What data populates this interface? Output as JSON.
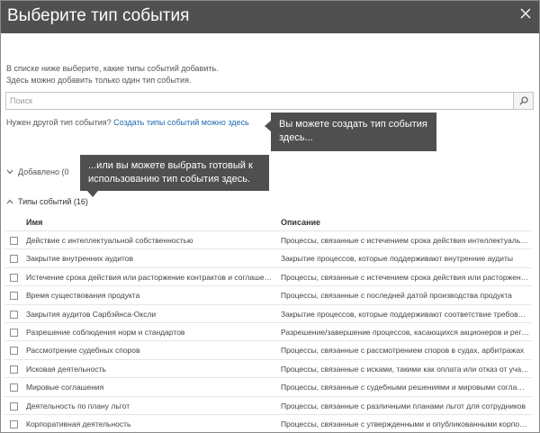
{
  "dialog": {
    "title": "Выберите тип события",
    "close_icon": "close-icon"
  },
  "intro": {
    "line1": "В списке ниже выберите, какие типы событий добавить.",
    "line2": "Здесь можно добавить только один тип события."
  },
  "search": {
    "placeholder": "Поиск",
    "value": "",
    "icon": "search-icon"
  },
  "other": {
    "prefix": "Нужен другой тип события?",
    "link": "Создать типы событий можно здесь"
  },
  "callouts": {
    "create": "Вы можете создать тип события здесь...",
    "choose": "...или вы можете выбрать готовый к использованию тип события здесь."
  },
  "sections": {
    "added": {
      "label": "Добавлено (0",
      "icon": "chevron-down-icon"
    },
    "types": {
      "label": "Типы событий (16)",
      "icon": "chevron-up-icon"
    }
  },
  "table": {
    "headers": {
      "name": "Имя",
      "description": "Описание"
    },
    "rows": [
      {
        "name": "Действие с интеллектуальной собственностью",
        "desc": "Процессы, связанные с истечением срока действия интеллектуальной собственности"
      },
      {
        "name": "Закрытие внутренних аудитов",
        "desc": "Закрытие процессов, которые поддерживают внутренние аудиты"
      },
      {
        "name": "Истечение срока действия или расторжение контрактов и соглашений",
        "desc": "Процессы, связанные с истечением срока действия или расторжением различных выполнений"
      },
      {
        "name": "Время существования продукта",
        "desc": "Процессы, связанные с последней датой производства продукта"
      },
      {
        "name": "Закрытия аудитов Сарбэйнса-Оксли",
        "desc": "Закрытие процессов, которые поддерживают соответствие требованиям"
      },
      {
        "name": "Разрешение соблюдения норм и стандартов",
        "desc": "Разрешение/завершение процессов, касающихся акционеров и регуляторов"
      },
      {
        "name": "Рассмотрение судебных споров",
        "desc": "Процессы, связанные с рассмотрением споров в судах, арбитражах"
      },
      {
        "name": "Исковая деятельность",
        "desc": "Процессы, связанные с исками, такими как оплата или отказ от участия"
      },
      {
        "name": "Мировые соглашения",
        "desc": "Процессы, связанные с судебными решениями и мировыми соглашениями"
      },
      {
        "name": "Деятельность по плану льгот",
        "desc": "Процессы, связанные с различными планами льгот для сотрудников"
      },
      {
        "name": "Корпоративная деятельность",
        "desc": "Процессы, связанные с утвержденными и опубликованными корпоративными решениями"
      }
    ]
  },
  "colors": {
    "header_bg": "#505050",
    "callout_bg": "#4f4f4f",
    "link": "#1f6ab0"
  }
}
